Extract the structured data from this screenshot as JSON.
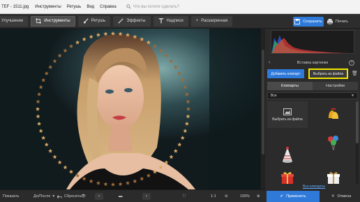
{
  "menubar": {
    "title": "TEF - 1511.jpg",
    "items": [
      "Инструменты",
      "Ретушь",
      "Вид",
      "Справка"
    ],
    "search_placeholder": "Что вы хотите сделать?"
  },
  "toolbar": {
    "buttons": [
      "Улучшение",
      "Инструменты",
      "Ретушь",
      "Эффекты",
      "Надписи",
      "Расширенная"
    ],
    "save": "Сохранить",
    "print": "Печать"
  },
  "panel": {
    "title": "Вставка картинки",
    "add_clipart": "Добавить клипарт",
    "from_file": "Выбрать из файла",
    "tabs": [
      "Клипарты",
      "Настройки"
    ],
    "category": "Все",
    "tile_upload_label": "Выбрать из файла",
    "clipart_library": "Все клипарты",
    "clips": [
      "bells-icon",
      "balloons-icon",
      "party-hat-icon",
      "gift-box-icon",
      "gift-box-white-icon"
    ]
  },
  "bottombar": {
    "before": "Показать",
    "before_after": "До/После",
    "reset": "Сбросить",
    "zoom_ratio": "1:1",
    "zoom_percent": "100%"
  },
  "footer": {
    "apply": "Применить",
    "cancel": "Отмена"
  },
  "colors": {
    "accent": "#2f7ad9",
    "highlight": "#f2e600"
  }
}
